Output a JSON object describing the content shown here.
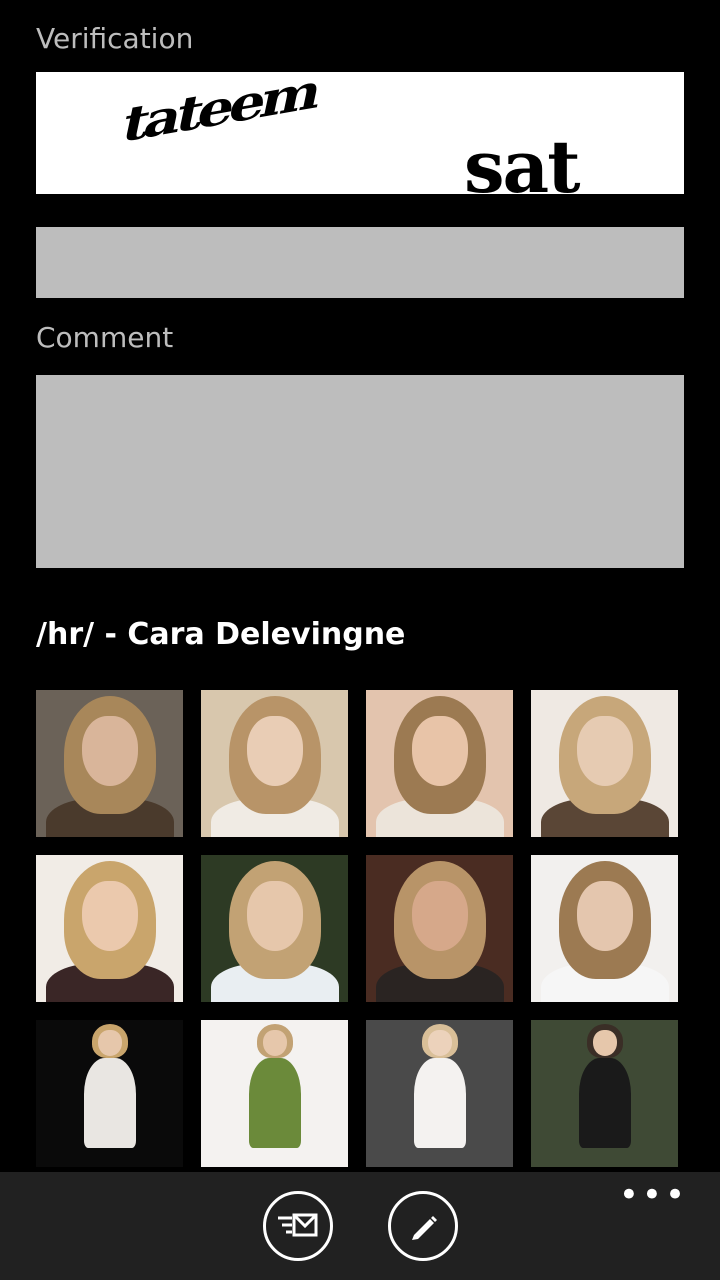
{
  "form": {
    "verification_label": "Verification",
    "captcha_words": [
      "tateem",
      "sat"
    ],
    "verification_value": "",
    "comment_label": "Comment",
    "comment_value": ""
  },
  "gallery": {
    "title": "/hr/ - Cara Delevingne",
    "thumbnails": [
      {
        "bg": "#6b6258",
        "hair": "#a8875a",
        "face": "#d9b59a",
        "body": "#4a3a2c"
      },
      {
        "bg": "#d8c7ad",
        "hair": "#b89468",
        "face": "#e9cdb5",
        "body": "#f0ebe4"
      },
      {
        "bg": "#e3c4ae",
        "hair": "#9c7a52",
        "face": "#e8c4a8",
        "body": "#ece4da"
      },
      {
        "bg": "#efe9e3",
        "hair": "#c7a77a",
        "face": "#e6cbb2",
        "body": "#5a4636"
      },
      {
        "bg": "#f1ece6",
        "hair": "#c9a56c",
        "face": "#ebc9ad",
        "body": "#3a2626"
      },
      {
        "bg": "#2d3a24",
        "hair": "#c2a274",
        "face": "#e6c7ab",
        "body": "#e9eef2"
      },
      {
        "bg": "#4a2c22",
        "hair": "#b89468",
        "face": "#d6a88a",
        "body": "#2a2422"
      },
      {
        "bg": "#f2f0ee",
        "hair": "#9c7a52",
        "face": "#e4c6ae",
        "body": "#f6f6f6"
      },
      {
        "bg": "#0a0a0a",
        "hair": "#c9a56c",
        "face": "#e6c7ab",
        "body": "#e9e6e2"
      },
      {
        "bg": "#f4f2f0",
        "hair": "#c2a274",
        "face": "#e6c7ab",
        "body": "#6b8a3a"
      },
      {
        "bg": "#4a4a4a",
        "hair": "#d9bf98",
        "face": "#ecd2bb",
        "body": "#f4f2f0"
      },
      {
        "bg": "#3f4a35",
        "hair": "#3a2e26",
        "face": "#e6c7ab",
        "body": "#1a1a1a"
      }
    ]
  },
  "appbar": {
    "buttons": [
      {
        "name": "reply-button",
        "icon": "reply-mail-icon"
      },
      {
        "name": "compose-button",
        "icon": "pencil-icon"
      }
    ],
    "more_label": "•••"
  }
}
